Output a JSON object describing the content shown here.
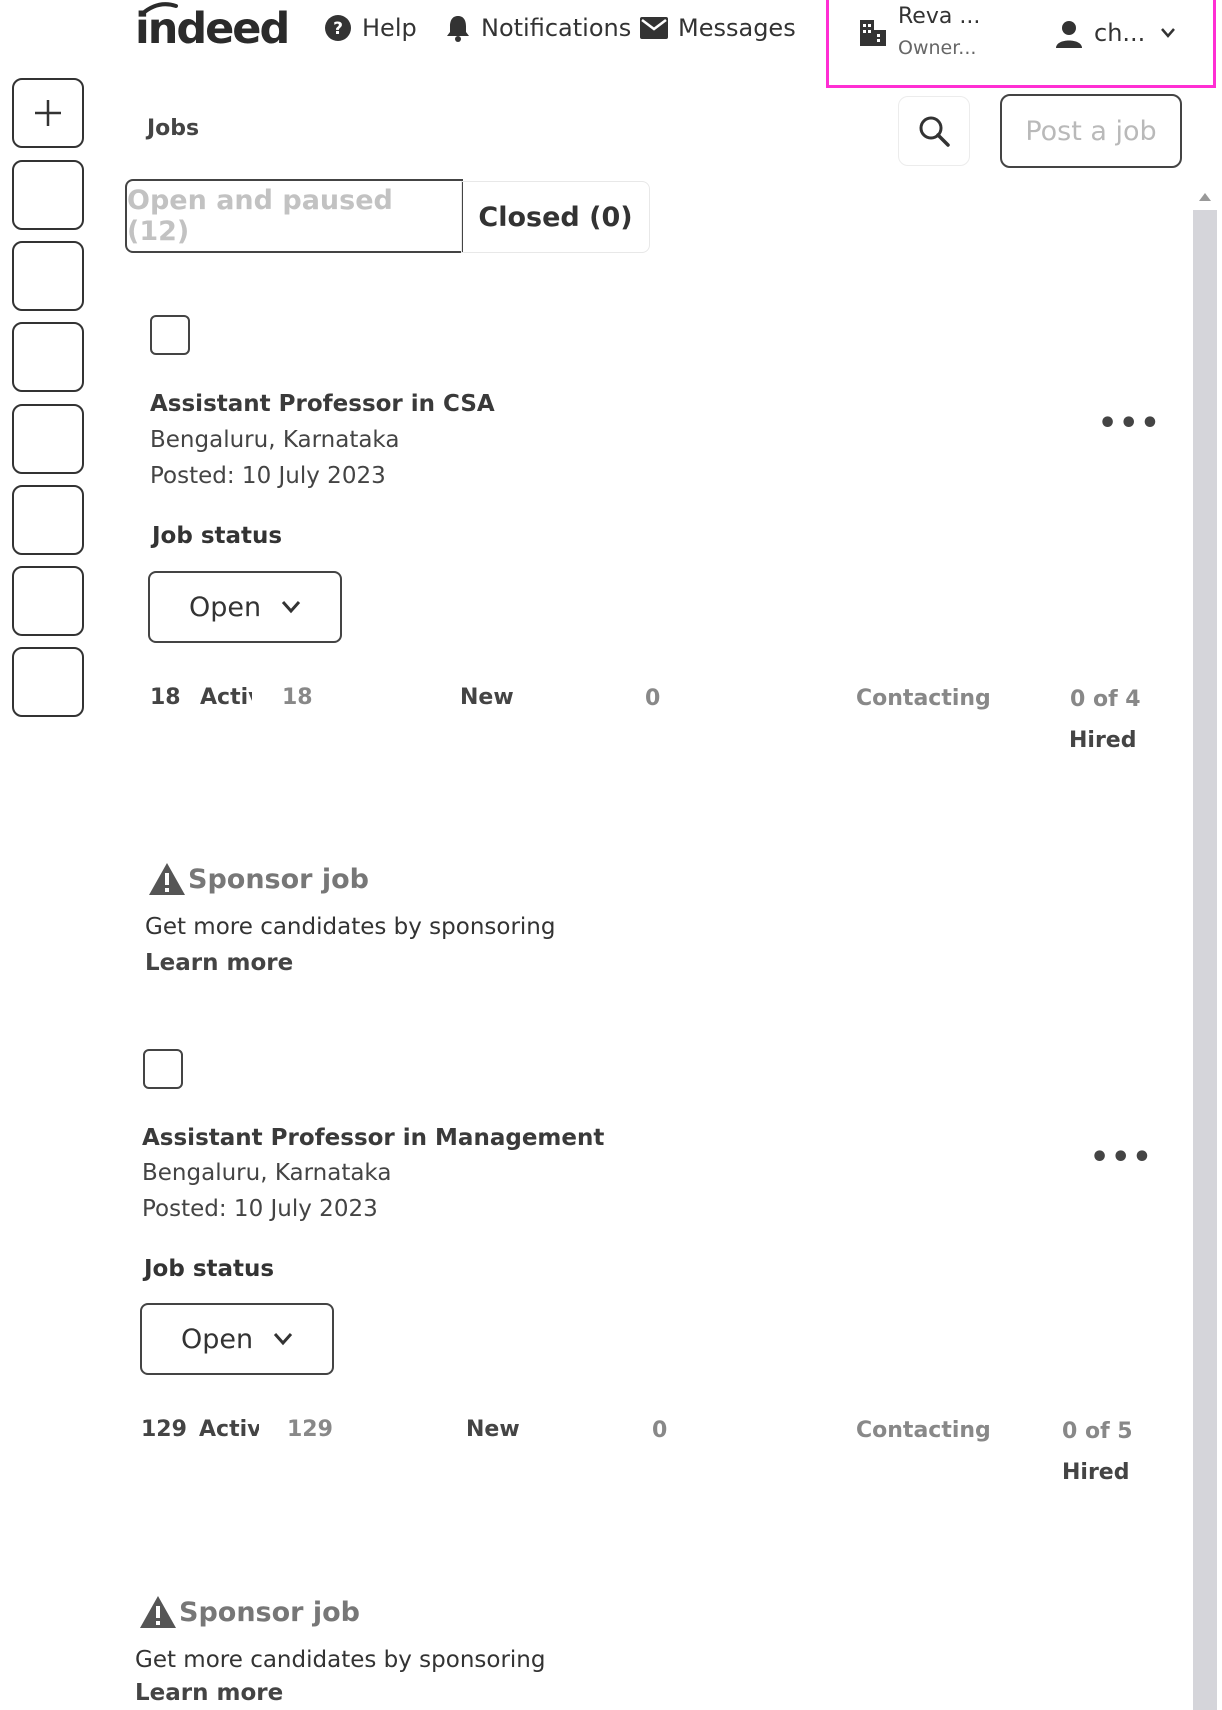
{
  "header": {
    "logo_text": "indeed",
    "nav": [
      {
        "label": "Help",
        "icon": "help-icon"
      },
      {
        "label": "Notifications",
        "icon": "bell-icon"
      },
      {
        "label": "Messages",
        "icon": "envelope-icon"
      }
    ],
    "account": {
      "org_name": "Reva ...",
      "org_role": "Owner...",
      "user_name": "ch...",
      "icon": "building-icon",
      "user_icon": "person-icon"
    }
  },
  "rail": {
    "add_icon": "plus-icon"
  },
  "toolbar": {
    "title": "Jobs",
    "search_icon": "search-icon",
    "post_job_label": "Post a job"
  },
  "tabs": [
    {
      "label": "Open and paused (12)",
      "active": true
    },
    {
      "label": "Closed (0)",
      "active": false
    }
  ],
  "jobs": [
    {
      "title": "Assistant Professor in CSA",
      "location": "Bengaluru, Karnataka",
      "posted": "Posted: 10 July 2023",
      "status_label": "Job status",
      "status_value": "Open",
      "active_count": "18",
      "active_label": "Active",
      "active_value": "18",
      "new_label": "New",
      "new_value": "0",
      "contacting_label": "Contacting",
      "hired_value": "0 of 4",
      "hired_label": "Hired",
      "sponsor_title": "Sponsor job",
      "sponsor_text": "Get more candidates by sponsoring",
      "learn_more": "Learn more"
    },
    {
      "title": "Assistant Professor in Management",
      "location": "Bengaluru, Karnataka",
      "posted": "Posted: 10 July 2023",
      "status_label": "Job status",
      "status_value": "Open",
      "active_count": "129",
      "active_label": "Active",
      "active_value": "129",
      "new_label": "New",
      "new_value": "0",
      "contacting_label": "Contacting",
      "hired_value": "0 of 5",
      "hired_label": "Hired",
      "sponsor_title": "Sponsor job",
      "sponsor_text": "Get more candidates by sponsoring",
      "learn_more": "Learn more"
    }
  ],
  "colors": {
    "highlight": "#ff2ed3",
    "text": "#2d2d2d",
    "muted": "#888888"
  }
}
